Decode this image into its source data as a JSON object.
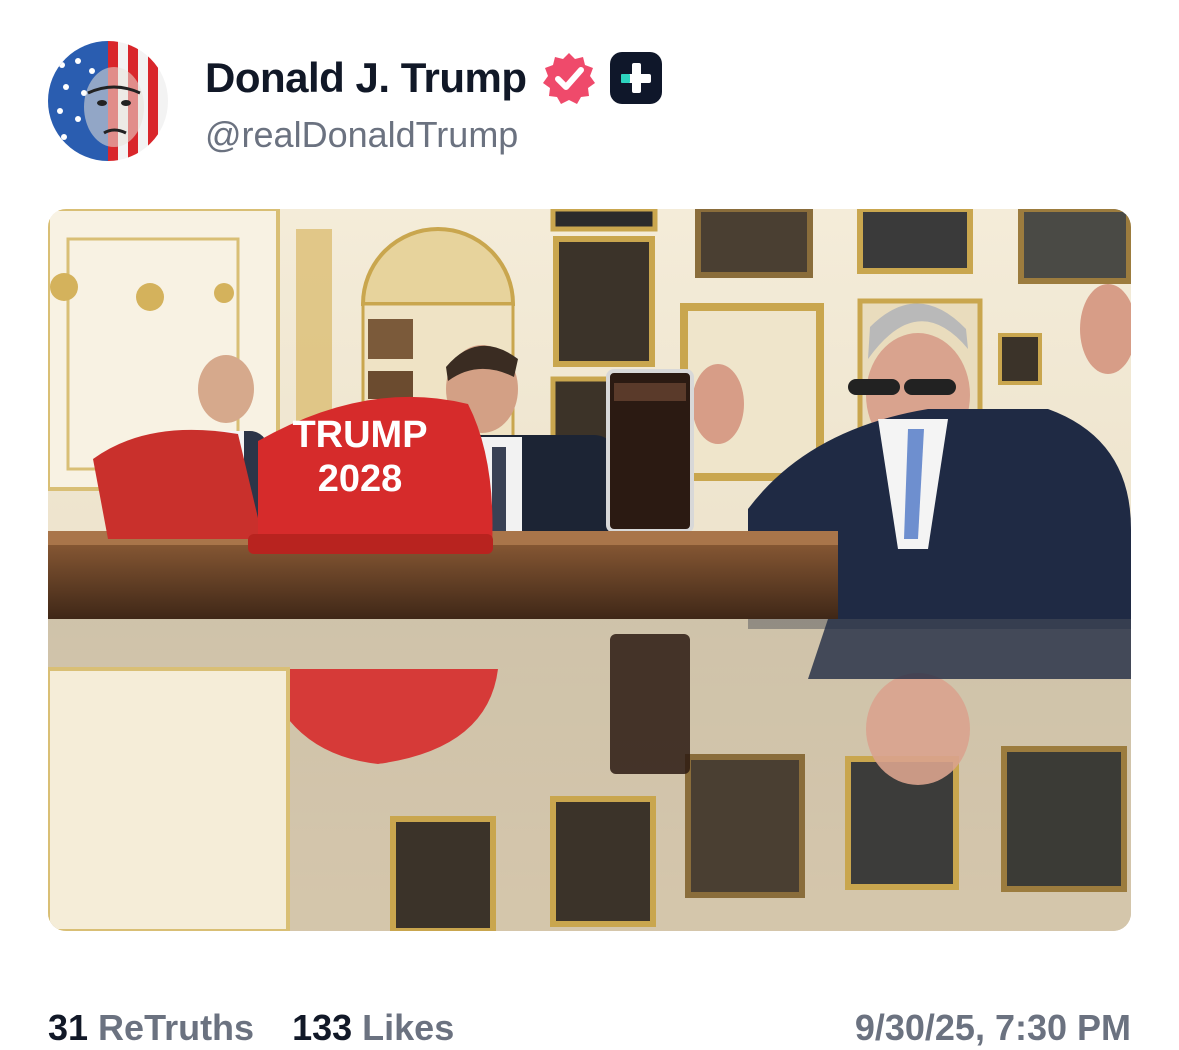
{
  "author": {
    "display_name": "Donald J. Trump",
    "handle": "@realDonaldTrump",
    "verified_icon": "verified-badge-icon",
    "plus_icon": "plus-subscription-icon",
    "brand_color": "#ef4a6b"
  },
  "media": {
    "hat_text_line1": "TRUMP",
    "hat_text_line2": "2028",
    "hat_color": "#d62b2b"
  },
  "stats": {
    "retruths_count": "31",
    "retruths_label": "ReTruths",
    "likes_count": "133",
    "likes_label": "Likes"
  },
  "timestamp": "9/30/25, 7:30 PM"
}
